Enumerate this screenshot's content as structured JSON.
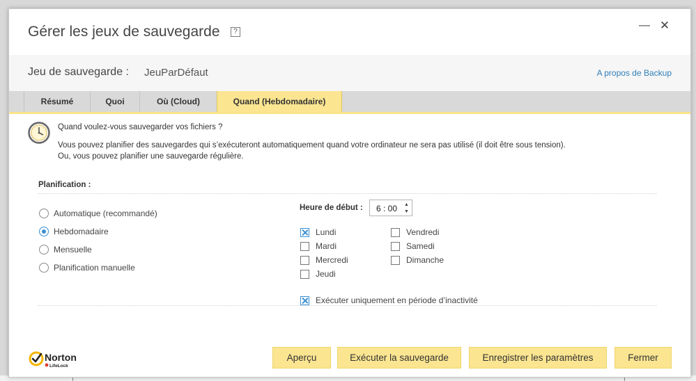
{
  "window": {
    "title": "Gérer les jeux de sauvegarde",
    "help_glyph": "?",
    "minimize_glyph": "—",
    "close_glyph": "✕"
  },
  "header": {
    "backup_set_label": "Jeu de sauvegarde :",
    "backup_set_name": "JeuParDéfaut",
    "about_link": "A propos de Backup"
  },
  "tabs": [
    {
      "label": "Résumé",
      "active": false
    },
    {
      "label": "Quoi",
      "active": false
    },
    {
      "label": "Où (Cloud)",
      "active": false
    },
    {
      "label": "Quand (Hebdomadaire)",
      "active": true
    }
  ],
  "intro": {
    "icon": "clock-icon",
    "question": "Quand voulez-vous sauvegarder vos fichiers ?",
    "line1": "Vous pouvez planifier des sauvegardes qui s’exécuteront automatiquement quand votre ordinateur ne sera pas utilisé (il doit être sous tension).",
    "line2": "Ou, vous pouvez planifier une sauvegarde régulière."
  },
  "schedule": {
    "label": "Planification :",
    "options": [
      {
        "label": "Automatique (recommandé)",
        "selected": false
      },
      {
        "label": "Hebdomadaire",
        "selected": true
      },
      {
        "label": "Mensuelle",
        "selected": false
      },
      {
        "label": "Planification manuelle",
        "selected": false
      }
    ],
    "start_time_label": "Heure de début :",
    "start_time_value": "6 : 00",
    "days": [
      {
        "label": "Lundi",
        "checked": true
      },
      {
        "label": "Mardi",
        "checked": false
      },
      {
        "label": "Mercredi",
        "checked": false
      },
      {
        "label": "Jeudi",
        "checked": false
      },
      {
        "label": "Vendredi",
        "checked": false
      },
      {
        "label": "Samedi",
        "checked": false
      },
      {
        "label": "Dimanche",
        "checked": false
      }
    ],
    "idle_only": {
      "label": "Exécuter uniquement en période d’inactivité",
      "checked": true
    }
  },
  "footer": {
    "logo_text": "Norton",
    "logo_subtext": "LifeLock",
    "buttons": {
      "preview": "Aperçu",
      "run_backup": "Exécuter la sauvegarde",
      "save_settings": "Enregistrer les paramètres",
      "close": "Fermer"
    }
  },
  "colors": {
    "accent_yellow": "#fbe591",
    "link_blue": "#2f7fb8",
    "check_blue": "#3a8fd3"
  }
}
